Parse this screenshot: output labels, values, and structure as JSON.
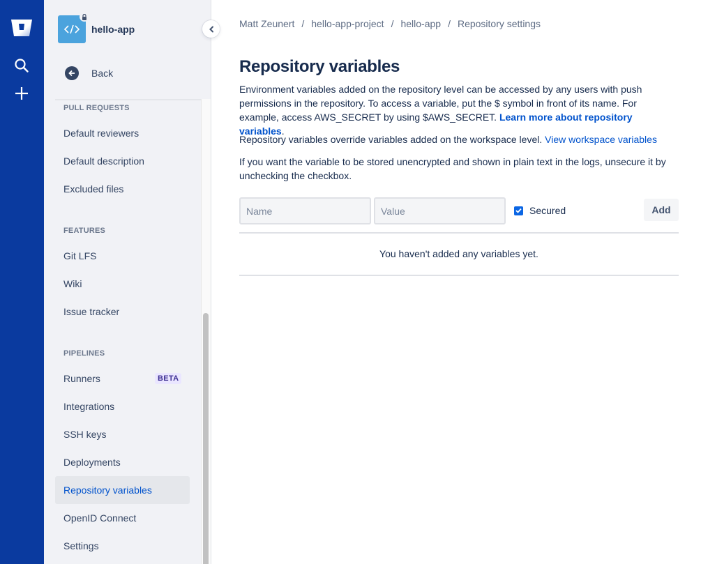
{
  "global_nav": {
    "logo": "bitbucket-logo",
    "icons": [
      "search-icon",
      "plus-icon"
    ]
  },
  "sidebar": {
    "repo_name": "hello-app",
    "repo_avatar_icon": "code-icon",
    "repo_avatar_color": "#4ba3dd",
    "back_label": "Back",
    "sections": [
      {
        "title": "PULL REQUESTS",
        "items": [
          {
            "label": "Default reviewers"
          },
          {
            "label": "Default description"
          },
          {
            "label": "Excluded files"
          }
        ]
      },
      {
        "title": "FEATURES",
        "items": [
          {
            "label": "Git LFS"
          },
          {
            "label": "Wiki"
          },
          {
            "label": "Issue tracker"
          }
        ]
      },
      {
        "title": "PIPELINES",
        "items": [
          {
            "label": "Runners",
            "badge": "BETA"
          },
          {
            "label": "Integrations"
          },
          {
            "label": "SSH keys"
          },
          {
            "label": "Deployments"
          },
          {
            "label": "Repository variables",
            "active": true
          },
          {
            "label": "OpenID Connect"
          },
          {
            "label": "Settings"
          }
        ]
      }
    ]
  },
  "breadcrumb": {
    "items": [
      "Matt Zeunert",
      "hello-app-project",
      "hello-app",
      "Repository settings"
    ],
    "separator": "/"
  },
  "page": {
    "title": "Repository variables",
    "para1_text": "Environment variables added on the repository level can be accessed by any users with push permissions in the repository. To access a variable, put the $ symbol in front of its name. For example, access AWS_SECRET by using $AWS_SECRET. ",
    "para1_link": "Learn more about repository variables",
    "para1_end": ".",
    "para2_text": "Repository variables override variables added on the workspace level. ",
    "para2_link": "View workspace variables",
    "para3_text": "If you want the variable to be stored unencrypted and shown in plain text in the logs, unsecure it by unchecking the checkbox.",
    "form": {
      "name_placeholder": "Name",
      "name_value": "",
      "value_placeholder": "Value",
      "value_value": "",
      "secured_label": "Secured",
      "secured_checked": true,
      "add_label": "Add"
    },
    "empty_message": "You haven't added any variables yet."
  },
  "colors": {
    "global_nav": "#0a3a9f",
    "link": "#0052cc",
    "checkbox": "#0b66e4"
  }
}
